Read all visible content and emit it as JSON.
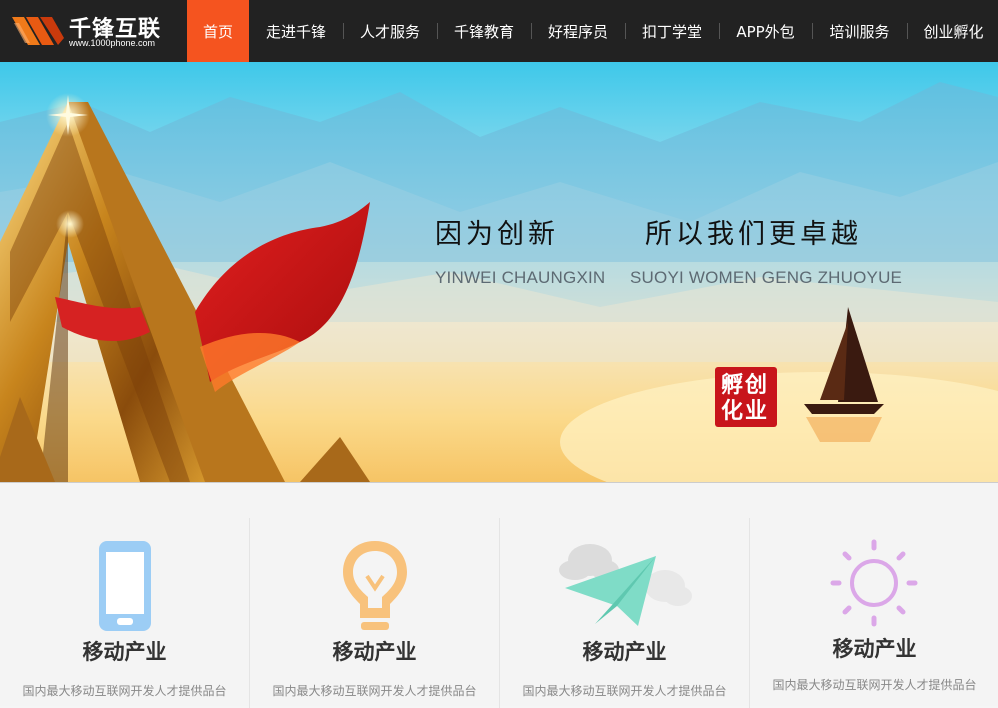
{
  "brand": {
    "name": "千锋互联",
    "url": "www.1000phone.com"
  },
  "nav": {
    "items": [
      {
        "label": "首页",
        "active": true
      },
      {
        "label": "走进千锋",
        "active": false
      },
      {
        "label": "人才服务",
        "active": false
      },
      {
        "label": "千锋教育",
        "active": false
      },
      {
        "label": "好程序员",
        "active": false
      },
      {
        "label": "扣丁学堂",
        "active": false
      },
      {
        "label": "APP外包",
        "active": false
      },
      {
        "label": "培训服务",
        "active": false
      },
      {
        "label": "创业孵化",
        "active": false
      }
    ]
  },
  "banner": {
    "slogan_part1": "因为创新",
    "slogan_part2": "所以我们更卓越",
    "pinyin_part1": "YINWEI CHAUNGXIN",
    "pinyin_part2": "SUOYI WOMEN GENG ZHUOYUE",
    "seal_text": "创业孵化"
  },
  "features": [
    {
      "icon": "phone-icon",
      "title": "移动产业",
      "desc": "国内最大移动互联网开发人才提供品台",
      "color": "#9ccdf5"
    },
    {
      "icon": "lightbulb-icon",
      "title": "移动产业",
      "desc": "国内最大移动互联网开发人才提供品台",
      "color": "#f8c27c"
    },
    {
      "icon": "paper-plane-icon",
      "title": "移动产业",
      "desc": "国内最大移动互联网开发人才提供品台",
      "color": "#7fdcc7"
    },
    {
      "icon": "sun-icon",
      "title": "移动产业",
      "desc": "国内最大移动互联网开发人才提供品台",
      "color": "#dba7e8"
    }
  ],
  "colors": {
    "nav_bg": "#222222",
    "nav_active": "#f5541f",
    "seal_red": "#c8151b"
  }
}
